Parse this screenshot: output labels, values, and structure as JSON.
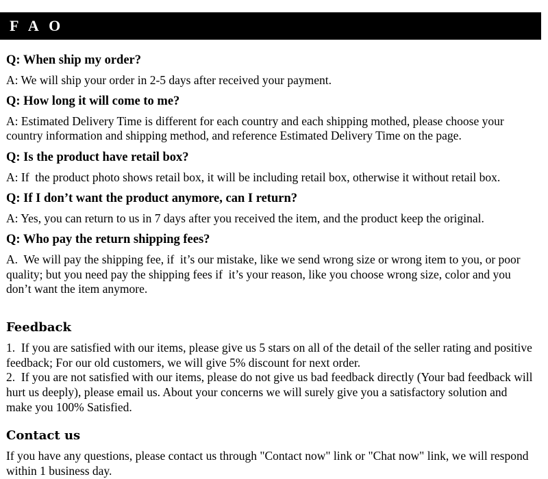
{
  "banner": {
    "title": "FAQ",
    "display_title": "F A O",
    "background_color": "#000000",
    "text_color": "#ffffff"
  },
  "faq": {
    "items": [
      {
        "question": "Q: When ship my order?",
        "answer": "A: We will ship your order in 2-5 days after received your payment."
      },
      {
        "question": "Q: How long it will come to me?",
        "answer": "A: Estimated Delivery Time is different for each country and each shipping mothed, please choose your country information and shipping method, and reference Estimated Delivery Time on the page."
      },
      {
        "question": "Q: Is the product have retail box?",
        "answer": "A: If  the product photo shows retail box, it will be including retail box, otherwise it without retail box."
      },
      {
        "question": "Q: If I don’t want the product anymore, can I return?",
        "answer": "A: Yes, you can return to us in 7 days after you received the item, and the product keep the original."
      },
      {
        "question": "Q: Who pay the return shipping fees?",
        "answer": "A.  We will pay the shipping fee, if  it’s our mistake, like we send wrong size or wrong item to you, or poor quality; but you need pay the shipping fees if  it’s your reason, like you choose wrong size, color and you don’t want the item anymore."
      }
    ]
  },
  "feedback": {
    "heading": "Feedback",
    "point_one": "1.  If you are satisfied with our items, please give us 5 stars on all of the detail of the seller rating and positive feedback; For our old customers, we will give 5% discount for next order.",
    "point_two": "2.  If you are not satisfied with our items, please do not give us bad feedback directly (Your bad feedback will hurt us deeply), please email us. About your concerns we will surely give you a satisfactory solution and make you 100% Satisfied."
  },
  "contact": {
    "heading": "Contact us",
    "text": "If you have any questions, please contact us through \"Contact now\" link or \"Chat now\" link, we will respond within 1 business day."
  }
}
